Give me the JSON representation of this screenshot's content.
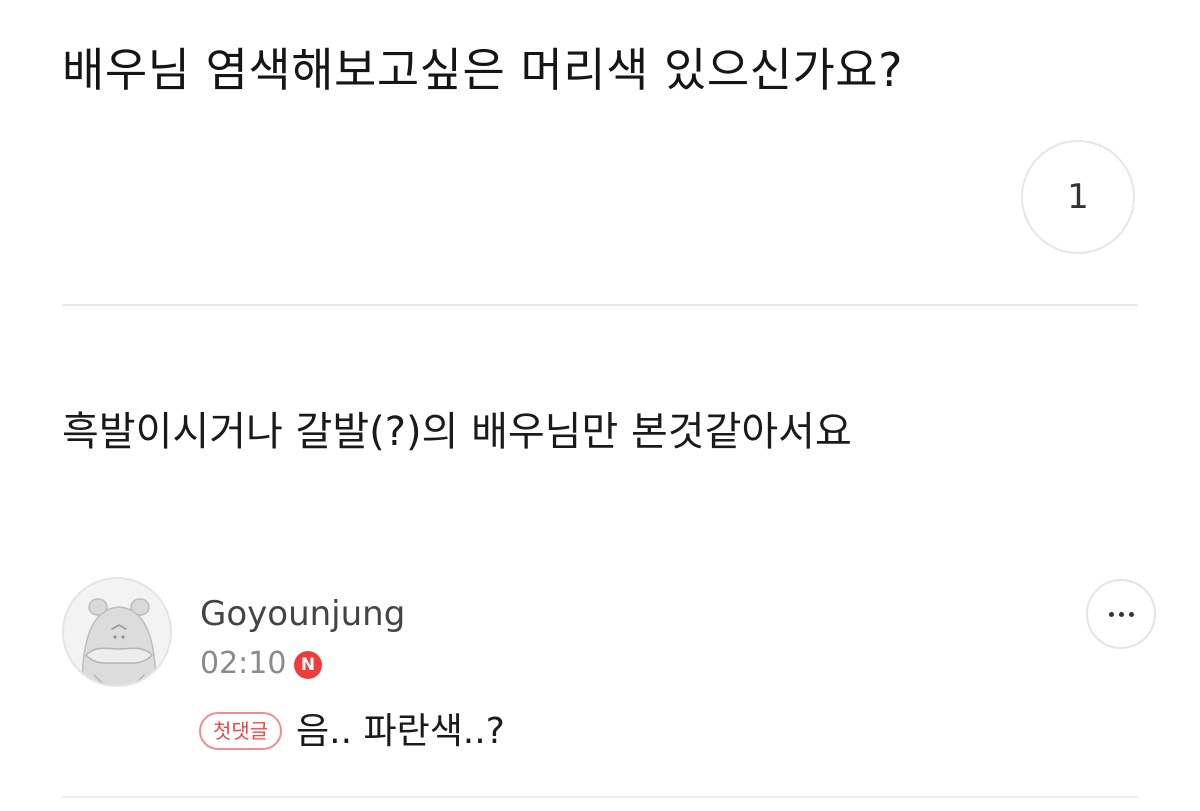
{
  "post": {
    "title": "배우님 염색해보고싶은 머리색 있으신가요?",
    "like_count": "1",
    "body": "흑발이시거나 갈발(?)의 배우님만 본것같아서요"
  },
  "comment": {
    "author": "Goyounjung",
    "time": "02:10",
    "new_badge": "N",
    "tag": "첫댓글",
    "text": "음.. 파란색..?"
  },
  "colors": {
    "new_badge": "#ee3b3b",
    "tag_border": "#f28d8d",
    "tag_text": "#e84a4a"
  },
  "icons": {
    "more": "more-dots-icon",
    "avatar": "default-avatar-icon"
  }
}
